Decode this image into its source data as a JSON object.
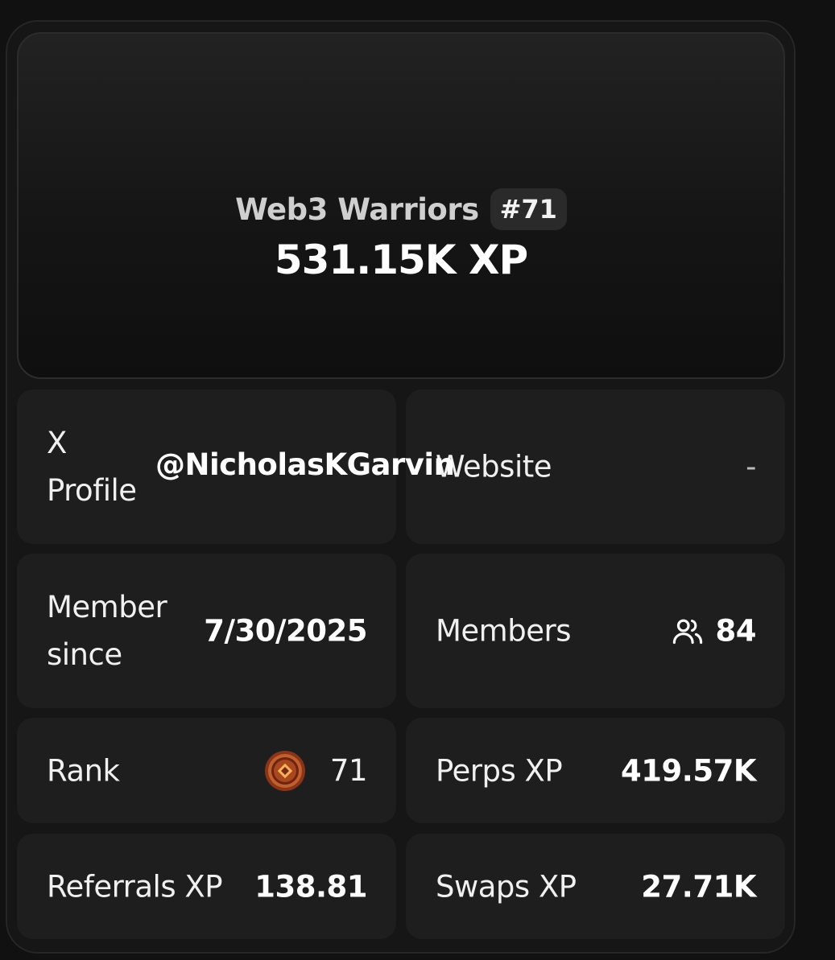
{
  "team": {
    "name": "Web3 Warriors",
    "rank_badge": "#71",
    "total_xp": "531.15K XP"
  },
  "stats": {
    "x_profile": {
      "label": "X\nProfile",
      "value": "@NicholasKGarvin"
    },
    "website": {
      "label": "Website",
      "value": "-"
    },
    "member_since": {
      "label": "Member\nsince",
      "value": "7/30/2025"
    },
    "members": {
      "label": "Members",
      "value": "84",
      "icon": "users-icon"
    },
    "rank": {
      "label": "Rank",
      "value": "71",
      "icon": "rank-medal-icon"
    },
    "perps_xp": {
      "label": "Perps XP",
      "value": "419.57K"
    },
    "referrals_xp": {
      "label": "Referrals XP",
      "value": "138.81"
    },
    "swaps_xp": {
      "label": "Swaps XP",
      "value": "27.71K"
    }
  },
  "colors": {
    "background": "#111111",
    "card": "#1e1e1e",
    "rank_medal": "#b5542a"
  }
}
